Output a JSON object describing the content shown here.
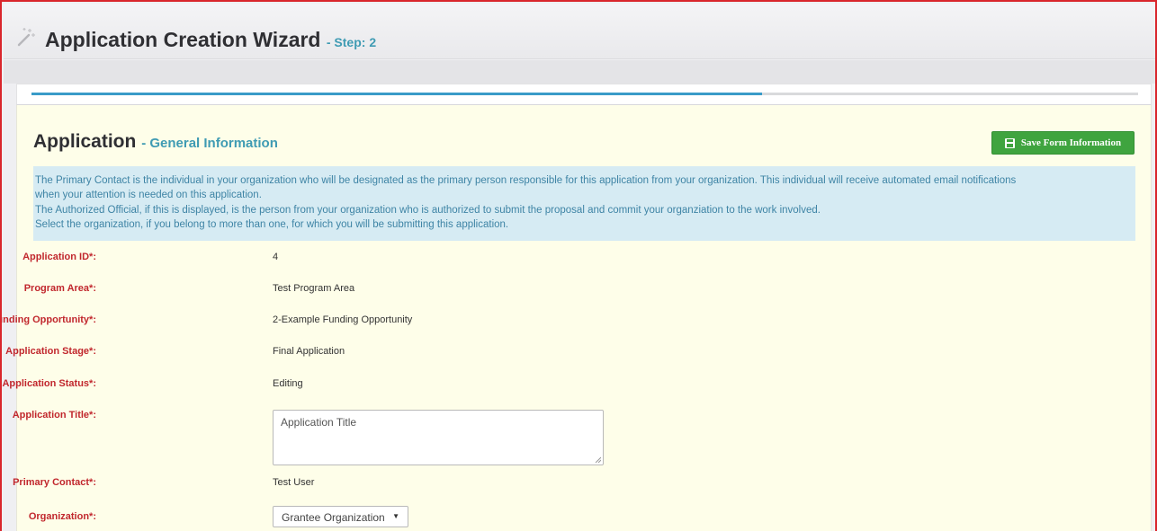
{
  "header": {
    "title": "Application Creation Wizard",
    "step": "- Step: 2",
    "icon": "magic-wand-icon"
  },
  "progress": {
    "fraction": 0.66
  },
  "section": {
    "title": "Application",
    "subtitle": "- General Information",
    "save_label": "Save Form Information",
    "save_icon": "floppy-disk-icon"
  },
  "info": {
    "line1": "The Primary Contact is the individual in your organization who will be designated as the primary person responsible for this application from your organization. This individual will receive automated email notifications",
    "line2": "when your attention is needed on this application.",
    "line3": "The Authorized Official, if this is displayed, is the person from your organization who is authorized to submit the proposal and commit your organziation to the work involved.",
    "line4": "Select the organization, if you belong to more than one, for which you will be submitting this application."
  },
  "fields": {
    "application_id": {
      "label": "Application ID*:",
      "value": "4"
    },
    "program_area": {
      "label": "Program Area*:",
      "value": "Test Program Area"
    },
    "funding_opportunity": {
      "label": "Funding Opportunity*:",
      "value": "2-Example Funding Opportunity"
    },
    "application_stage": {
      "label": "Application Stage*:",
      "value": "Final Application"
    },
    "application_status": {
      "label": "Application Status*:",
      "value": "Editing"
    },
    "application_title": {
      "label": "Application Title*:",
      "value": "Application Title"
    },
    "primary_contact": {
      "label": "Primary Contact*:",
      "value": "Test User"
    },
    "organization": {
      "label": "Organization*:",
      "value": "Grantee Organization",
      "caret": "▼"
    }
  },
  "colors": {
    "frame_border": "#d9262c",
    "label_red": "#c1272d",
    "accent_teal": "#3f9bb3",
    "save_green": "#3fa43f",
    "info_bg": "#d6ebf3",
    "content_bg": "#fefee9",
    "progress_blue": "#3a9bc8"
  }
}
